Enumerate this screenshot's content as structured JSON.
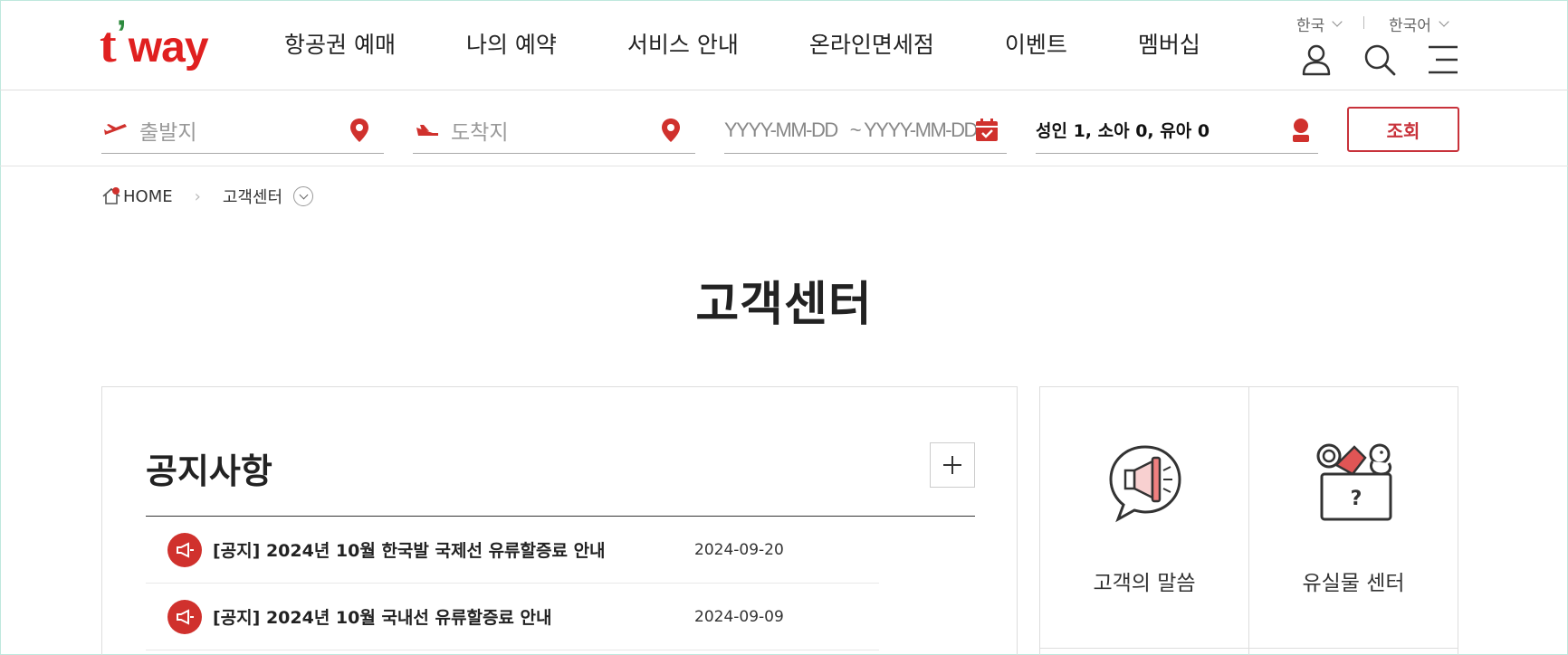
{
  "header": {
    "logo": {
      "t": "t",
      "apos": "’",
      "way": "way"
    },
    "nav": [
      "항공권 예매",
      "나의 예약",
      "서비스 안내",
      "온라인면세점",
      "이벤트",
      "멤버십"
    ],
    "region": "한국",
    "language": "한국어"
  },
  "search": {
    "departure_placeholder": "출발지",
    "arrival_placeholder": "도착지",
    "date_start_placeholder": "YYYY-MM-DD",
    "date_sep": "~",
    "date_end_placeholder": "YYYY-MM-DD",
    "passengers": "성인 1, 소아 0, 유아 0",
    "search_label": "조회"
  },
  "breadcrumb": {
    "home": "HOME",
    "current": "고객센터"
  },
  "page_title": "고객센터",
  "notice": {
    "title": "공지사항",
    "items": [
      {
        "text": "[공지] 2024년 10월 한국발 국제선 유류할증료 안내",
        "date": "2024-09-20"
      },
      {
        "text": "[공지] 2024년 10월 국내선 유류할증료 안내",
        "date": "2024-09-09"
      }
    ]
  },
  "quick_links": [
    {
      "label": "고객의 말씀",
      "icon": "megaphone-icon"
    },
    {
      "label": "유실물 센터",
      "icon": "lost-and-found-icon"
    }
  ],
  "colors": {
    "brand": "#e02020",
    "accent": "#c8323b",
    "leaf": "#2d8a3e"
  }
}
